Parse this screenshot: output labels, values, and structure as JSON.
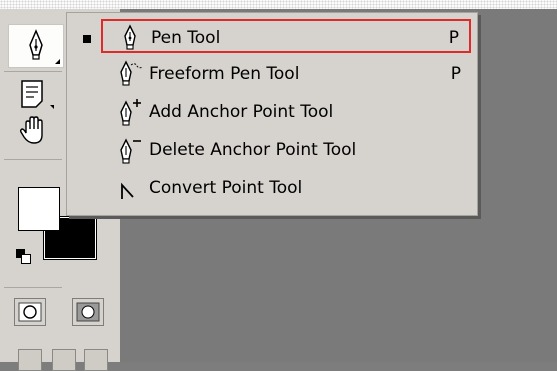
{
  "tool_menu": {
    "items": [
      {
        "label": "Pen Tool",
        "shortcut": "P",
        "icon": "pen-icon",
        "selected": true
      },
      {
        "label": "Freeform Pen Tool",
        "shortcut": "P",
        "icon": "freeform-pen-icon",
        "selected": false
      },
      {
        "label": "Add Anchor Point Tool",
        "shortcut": "",
        "icon": "add-anchor-point-icon",
        "selected": false
      },
      {
        "label": "Delete Anchor Point Tool",
        "shortcut": "",
        "icon": "delete-anchor-point-icon",
        "selected": false
      },
      {
        "label": "Convert Point Tool",
        "shortcut": "",
        "icon": "convert-point-icon",
        "selected": false
      }
    ]
  },
  "toolbox": {
    "tools": [
      {
        "name": "pen-tool",
        "icon": "pen-icon"
      },
      {
        "name": "notes-tool",
        "icon": "notes-icon"
      },
      {
        "name": "hand-tool",
        "icon": "hand-icon"
      }
    ]
  },
  "colors": {
    "highlight_border": "#e02a2a",
    "panel_bg": "#d6d3ce",
    "workspace_bg": "#7a7a7a",
    "foreground_swatch": "#ffffff",
    "background_swatch": "#000000"
  }
}
